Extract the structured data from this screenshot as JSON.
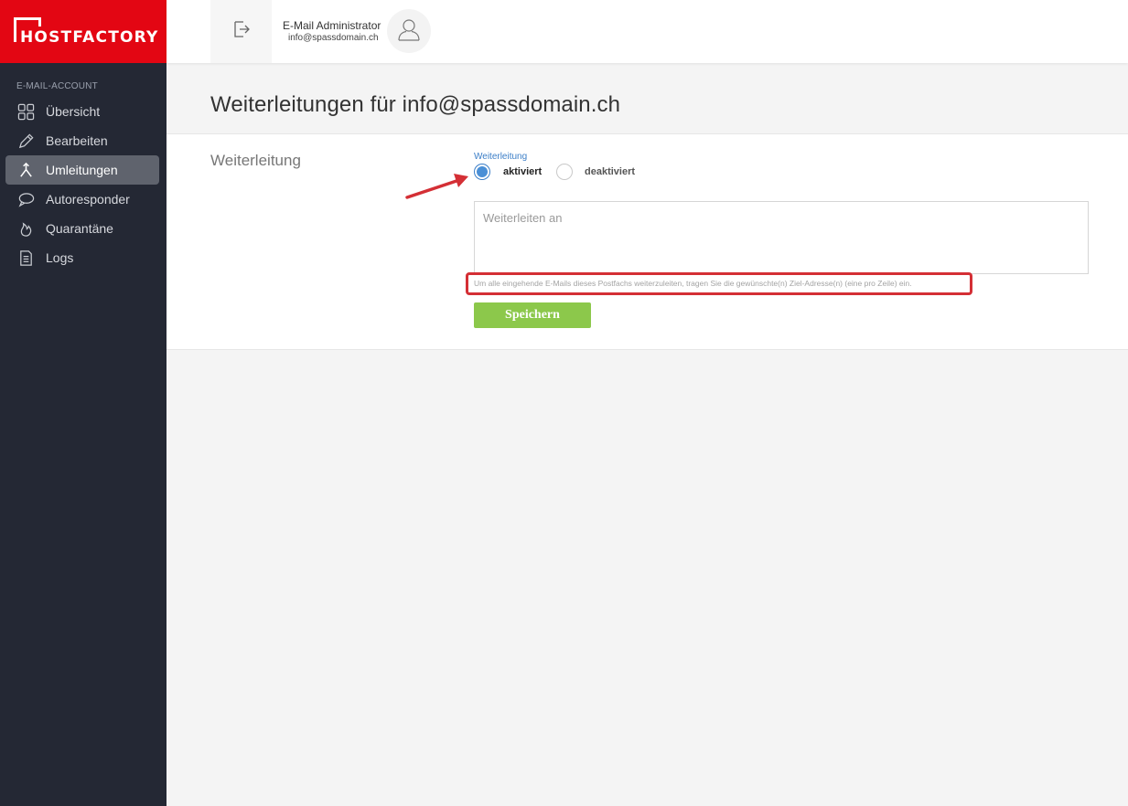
{
  "brand": {
    "name": "HOSTFACTORY",
    "color": "#e30613"
  },
  "sidebar": {
    "heading": "E-MAIL-ACCOUNT",
    "items": [
      {
        "label": "Übersicht",
        "icon": "grid-icon",
        "active": false
      },
      {
        "label": "Bearbeiten",
        "icon": "pencil-icon",
        "active": false
      },
      {
        "label": "Umleitungen",
        "icon": "fork-arrows-icon",
        "active": true
      },
      {
        "label": "Autoresponder",
        "icon": "speech-bubble-icon",
        "active": false
      },
      {
        "label": "Quarantäne",
        "icon": "flame-icon",
        "active": false
      },
      {
        "label": "Logs",
        "icon": "document-icon",
        "active": false
      }
    ]
  },
  "header": {
    "logout_icon": "logout-icon",
    "user_name": "E-Mail Administrator",
    "user_email": "info@spassdomain.ch",
    "avatar_icon": "user-icon"
  },
  "page": {
    "title": "Weiterleitungen für info@spassdomain.ch"
  },
  "form": {
    "section_label": "Weiterleitung",
    "field_label": "Weiterleitung",
    "options": [
      {
        "label": "aktiviert",
        "selected": true
      },
      {
        "label": "deaktiviert",
        "selected": false
      }
    ],
    "textarea_placeholder": "Weiterleiten an",
    "textarea_value": "",
    "help_text": "Um alle eingehende E-Mails dieses Postfachs weiterzuleiten, tragen Sie die gewünschte(n) Ziel-Adresse(n) (eine pro Zeile) ein.",
    "save_label": "Speichern"
  },
  "colors": {
    "accent": "#4a8fd6",
    "save": "#8cc84b",
    "highlight": "#d42f35",
    "sidebar_bg": "#242834"
  }
}
